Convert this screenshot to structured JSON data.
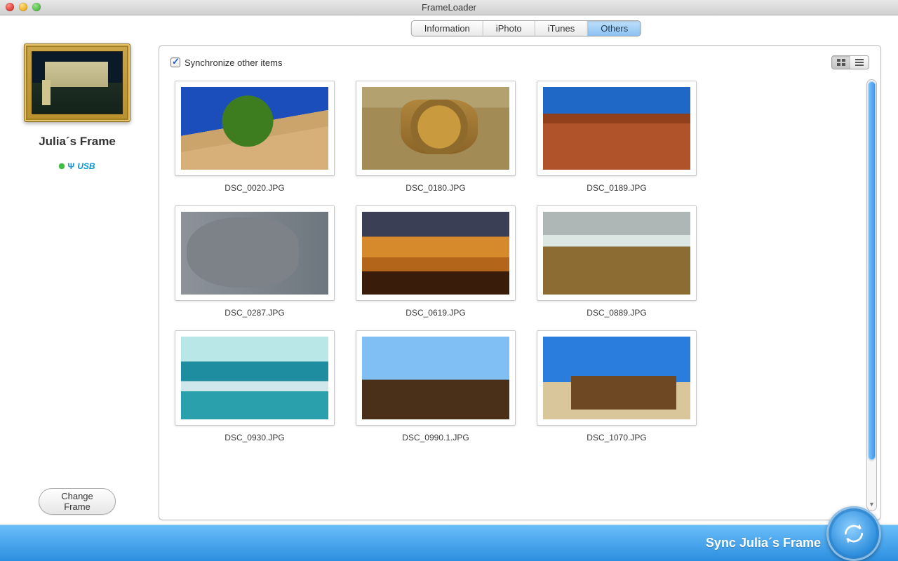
{
  "window": {
    "title": "FrameLoader"
  },
  "sidebar": {
    "frame_name": "Julia´s Frame",
    "connection_label": "USB",
    "change_button": "Change Frame"
  },
  "tabs": {
    "items": [
      "Information",
      "iPhoto",
      "iTunes",
      "Others"
    ],
    "active_index": 3
  },
  "panel": {
    "sync_checkbox_label": "Synchronize other items",
    "sync_checked": true,
    "view_mode": "grid"
  },
  "photos": [
    {
      "filename": "DSC_0020.JPG"
    },
    {
      "filename": "DSC_0180.JPG"
    },
    {
      "filename": "DSC_0189.JPG"
    },
    {
      "filename": "DSC_0287.JPG"
    },
    {
      "filename": "DSC_0619.JPG"
    },
    {
      "filename": "DSC_0889.JPG"
    },
    {
      "filename": "DSC_0930.JPG"
    },
    {
      "filename": "DSC_0990.1.JPG"
    },
    {
      "filename": "DSC_1070.JPG"
    }
  ],
  "bottombar": {
    "sync_label": "Sync Julia´s Frame"
  }
}
